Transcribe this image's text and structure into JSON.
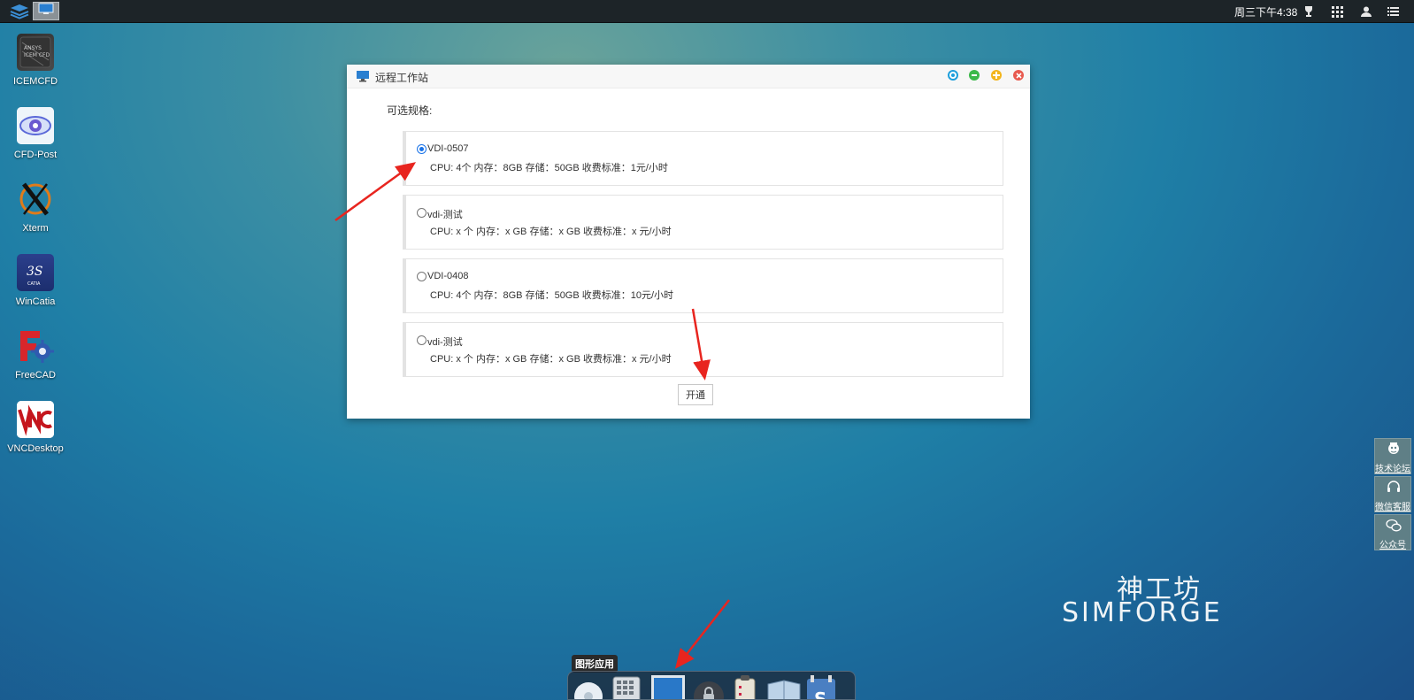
{
  "topbar": {
    "clock": "周三下午4:38",
    "launcher_icon": "layers-icon",
    "task_icon": "monitor-icon",
    "tray_icons": [
      "trophy-icon",
      "grid-icon",
      "user-icon",
      "menu-icon"
    ]
  },
  "desktop": {
    "icons": [
      {
        "label": "ICEMCFD",
        "icon": "icemcfd-icon"
      },
      {
        "label": "CFD-Post",
        "icon": "eye-icon"
      },
      {
        "label": "Xterm",
        "icon": "x-logo-icon"
      },
      {
        "label": "WinCatia",
        "icon": "catia-icon"
      },
      {
        "label": "FreeCAD",
        "icon": "freecad-icon"
      },
      {
        "label": "VNCDesktop",
        "icon": "vnc-icon"
      }
    ]
  },
  "window": {
    "title": "远程工作站",
    "spec_label": "可选规格:",
    "options": [
      {
        "name": "VDI-0507",
        "desc": "CPU: 4个 内存：8GB 存储：50GB 收费标准：1元/小时",
        "checked": true
      },
      {
        "name": "vdi-测试",
        "desc": "CPU: x 个 内存：x GB 存储：x GB 收费标准：x 元/小时",
        "checked": false
      },
      {
        "name": "VDI-0408",
        "desc": "CPU: 4个 内存：8GB 存储：50GB 收费标准：10元/小时",
        "checked": false
      },
      {
        "name": "vdi-测试",
        "desc": "CPU: x 个 内存：x GB 存储：x GB 收费标准：x 元/小时",
        "checked": false
      }
    ],
    "open_button": "开通",
    "colors": {
      "blue": "#1e9fdc",
      "green": "#3cb94a",
      "yellow": "#f3b51c",
      "red": "#e85a4f"
    }
  },
  "side_panel": {
    "items": [
      {
        "label": "技术论坛",
        "icon": "forum-icon"
      },
      {
        "label": "微信客服",
        "icon": "headset-icon"
      },
      {
        "label": "公众号",
        "icon": "wechat-icon"
      }
    ]
  },
  "brand": {
    "cn": "神工坊",
    "en": "SIMFORGE"
  },
  "dock": {
    "tooltip": "图形应用",
    "items": [
      "disc-icon",
      "calculator-icon",
      "monitor-icon",
      "lock-icon",
      "clipboard-icon",
      "book-icon",
      "s-app-icon"
    ]
  }
}
